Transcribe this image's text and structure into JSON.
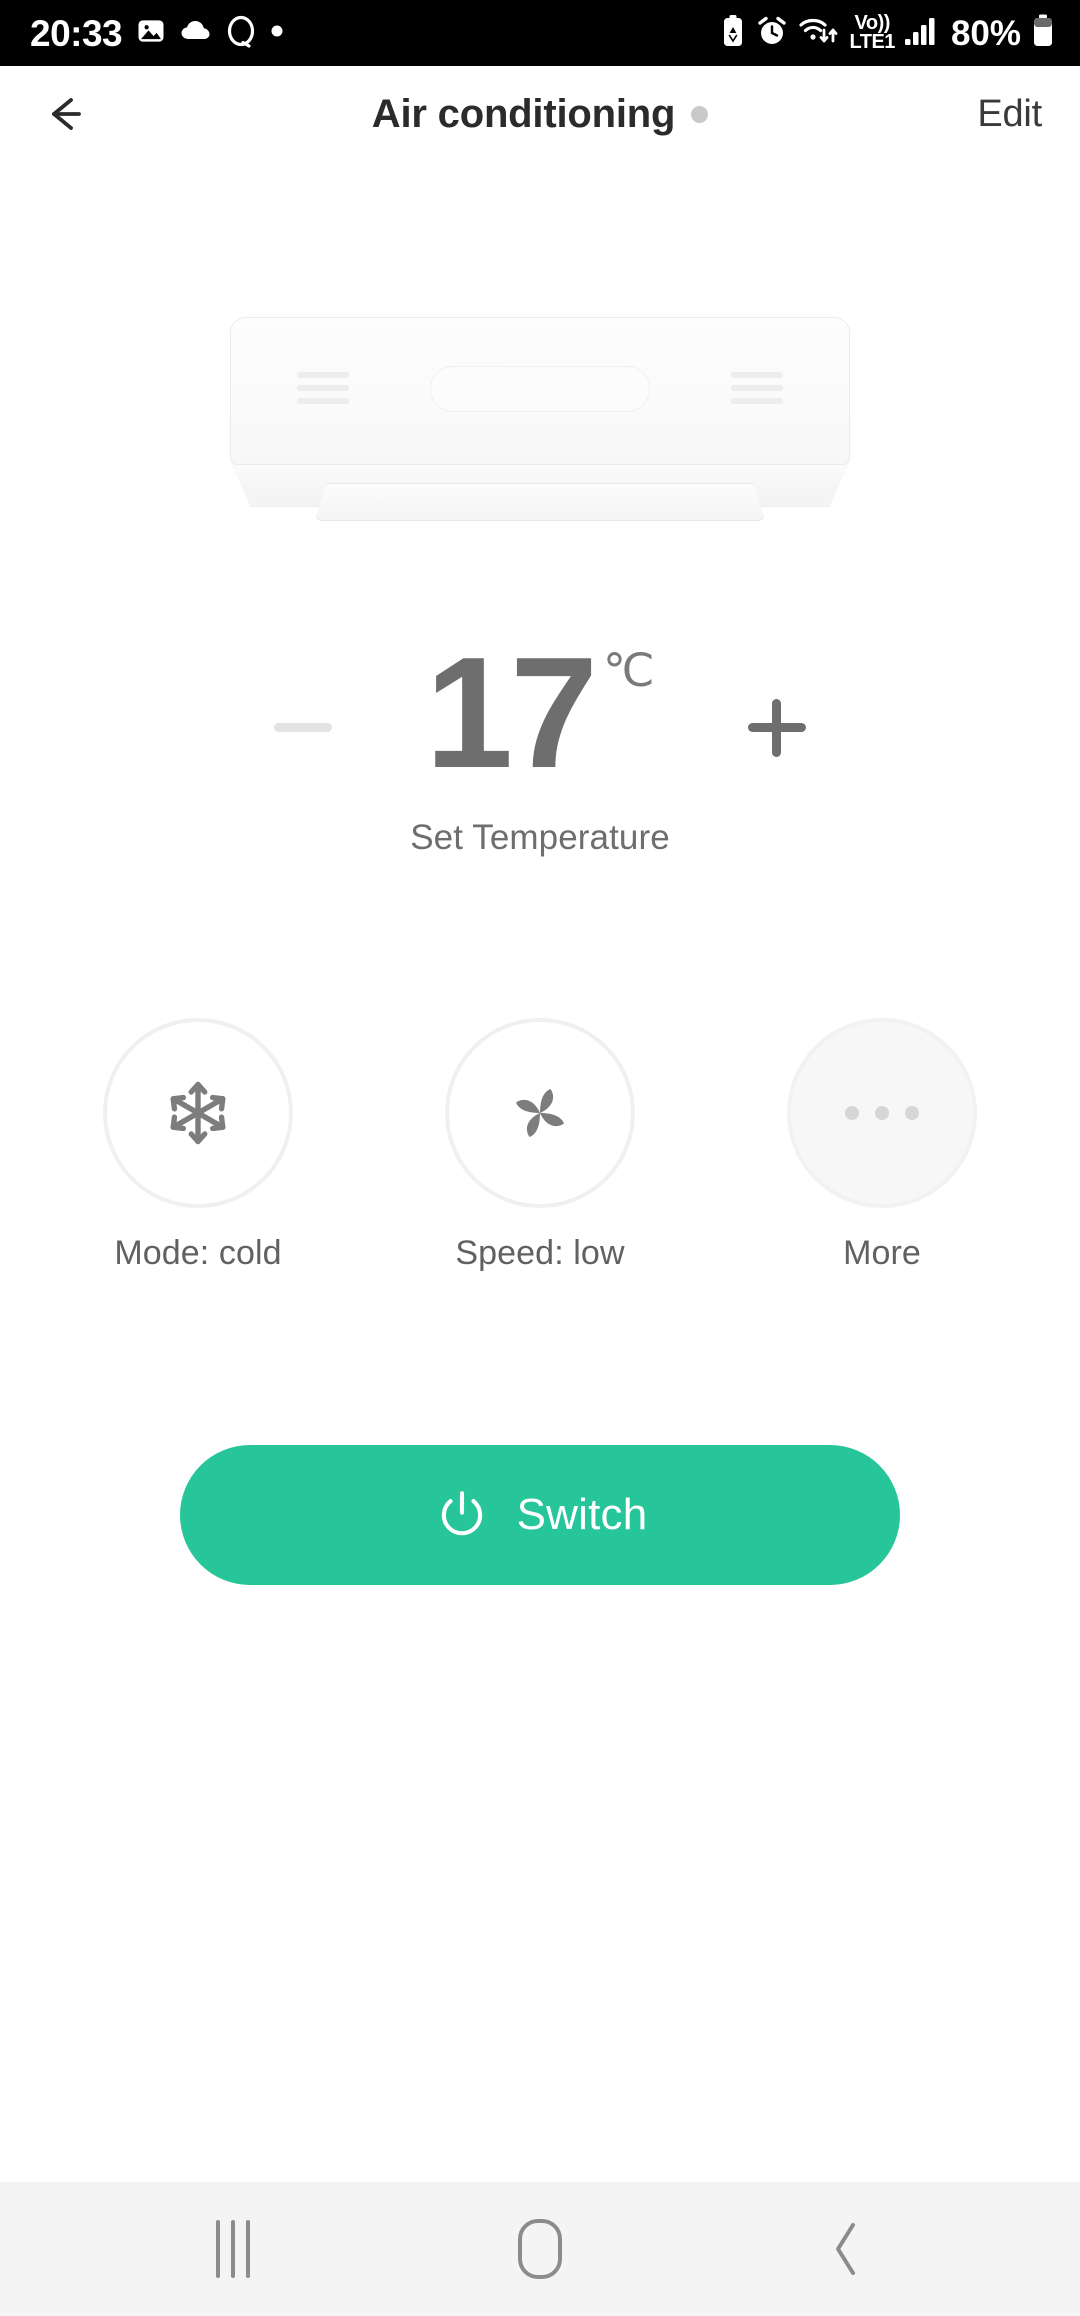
{
  "status_bar": {
    "clock": "20:33",
    "battery_percent": "80%",
    "volte_line1": "Vo))",
    "volte_line2": "LTE1",
    "left_icons": [
      "gallery-image-icon",
      "cloud-icon",
      "bixby-circle-icon",
      "dot-icon"
    ],
    "right_icons": [
      "battery-saver-icon",
      "alarm-clock-icon",
      "wifi-transfer-icon",
      "volte-label",
      "signal-bars-icon",
      "battery-icon"
    ],
    "background": "#000000",
    "foreground": "#ffffff"
  },
  "header": {
    "back_icon": "back-arrow-icon",
    "title": "Air conditioning",
    "status_dot_color": "#c9c9c9",
    "edit_label": "Edit"
  },
  "device": {
    "art_name": "wall-mounted-air-conditioner-illustration"
  },
  "thermostat": {
    "decrease_label": "−",
    "increase_label": "+",
    "value": "17",
    "unit": "℃",
    "caption": "Set Temperature",
    "decrease_enabled": "false",
    "increase_enabled": "true",
    "value_color": "#6e6e6e",
    "minus_color": "#e3e3e3",
    "plus_color": "#6e6e6e"
  },
  "controls": [
    {
      "icon": "snowflake-icon",
      "label": "Mode: cold",
      "state": "active"
    },
    {
      "icon": "fan-pinwheel-icon",
      "label": "Speed: low",
      "state": "active"
    },
    {
      "icon": "ellipsis-icon",
      "label": "More",
      "state": "dimmed"
    }
  ],
  "switch_button": {
    "label": "Switch",
    "icon": "power-icon",
    "color": "#26c59a",
    "text_color": "#ffffff"
  },
  "nav_bar": {
    "background": "#f4f4f4",
    "items": [
      {
        "name": "recents-button",
        "icon": "recents-icon"
      },
      {
        "name": "home-button",
        "icon": "home-icon"
      },
      {
        "name": "back-button",
        "icon": "back-chevron-icon"
      }
    ]
  }
}
